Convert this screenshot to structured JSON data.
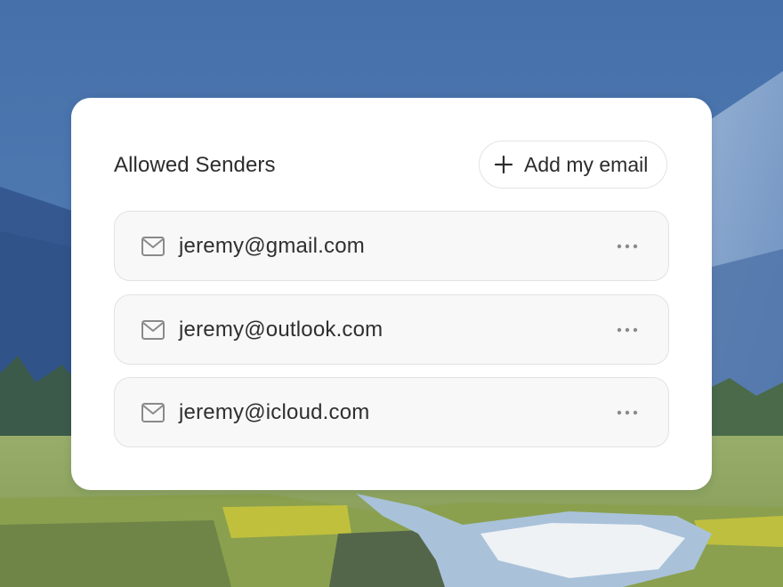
{
  "card": {
    "title": "Allowed Senders",
    "add_button_label": "Add my email"
  },
  "senders": [
    {
      "email": "jeremy@gmail.com"
    },
    {
      "email": "jeremy@outlook.com"
    },
    {
      "email": "jeremy@icloud.com"
    }
  ],
  "icons": {
    "add": "plus-icon",
    "sender": "mail-icon",
    "menu": "more-horizontal-icon"
  },
  "colors": {
    "card_bg": "#ffffff",
    "row_bg": "#f8f8f8",
    "text": "#2c2c2c",
    "icon": "#8a8a8a"
  }
}
